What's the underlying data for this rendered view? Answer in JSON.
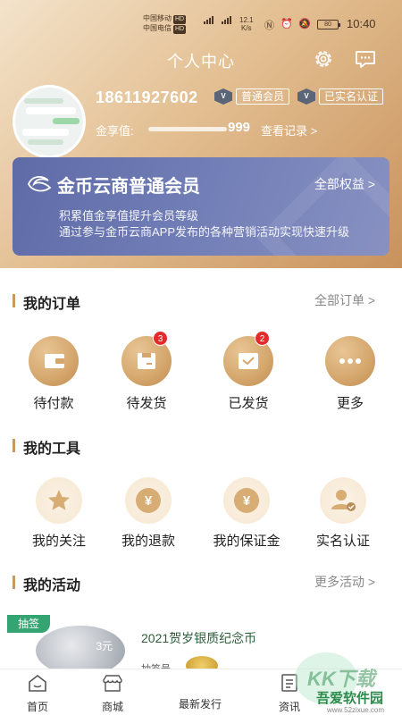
{
  "status_bar": {
    "carrier1": "中国移动",
    "carrier2": "中国电信",
    "hd": "HD",
    "speed_value": "12.1",
    "speed_unit": "K/s",
    "battery": "80",
    "time": "10:40"
  },
  "header": {
    "title": "个人中心",
    "settings_icon": "gear-icon",
    "message_icon": "message-icon"
  },
  "profile": {
    "phone": "18611927602",
    "member_badge": "普通会员",
    "verified_badge": "已实名认证",
    "points_label": "金享值:",
    "points_value": "999",
    "view_records": "查看记录 >"
  },
  "member_card": {
    "title": "金币云商普通会员",
    "all_benefits": "全部权益 >",
    "desc_line1": "积累值金享值提升会员等级",
    "desc_line2": "通过参与金币云商APP发布的各种营销活动实现快速升级"
  },
  "orders": {
    "title": "我的订单",
    "more": "全部订单 >",
    "items": [
      {
        "label": "待付款",
        "icon": "wallet-icon"
      },
      {
        "label": "待发货",
        "icon": "package-icon",
        "count": "3"
      },
      {
        "label": "已发货",
        "icon": "shipped-box-icon",
        "count": "2"
      },
      {
        "label": "更多",
        "icon": "more-dots-icon"
      }
    ]
  },
  "tools": {
    "title": "我的工具",
    "items": [
      {
        "label": "我的关注",
        "icon": "star-icon"
      },
      {
        "label": "我的退款",
        "icon": "refund-icon",
        "glyph": "¥"
      },
      {
        "label": "我的保证金",
        "icon": "deposit-icon",
        "glyph": "¥"
      },
      {
        "label": "实名认证",
        "icon": "user-verify-icon"
      }
    ]
  },
  "activities": {
    "title": "我的活动",
    "more": "更多活动 >",
    "card": {
      "tag": "抽签",
      "coin_value": "3元",
      "title": "2021贺岁银质纪念币",
      "lottery_no_label": "抽签号"
    }
  },
  "tabbar": {
    "items": [
      {
        "label": "首页",
        "icon": "home-icon"
      },
      {
        "label": "商城",
        "icon": "store-icon"
      },
      {
        "label": "最新发行",
        "icon": "new-release-icon"
      },
      {
        "label": "资讯",
        "icon": "news-icon"
      }
    ]
  },
  "watermark": {
    "logo": "KK下载",
    "text": "吾爱软件园",
    "url": "www.52zixue.com"
  },
  "colors": {
    "header_gold": "#e3bf92",
    "card_blue": "#6d78b3",
    "accent_gold": "#c59a63",
    "badge_red": "#e22b2b",
    "tag_green": "#35a473"
  }
}
